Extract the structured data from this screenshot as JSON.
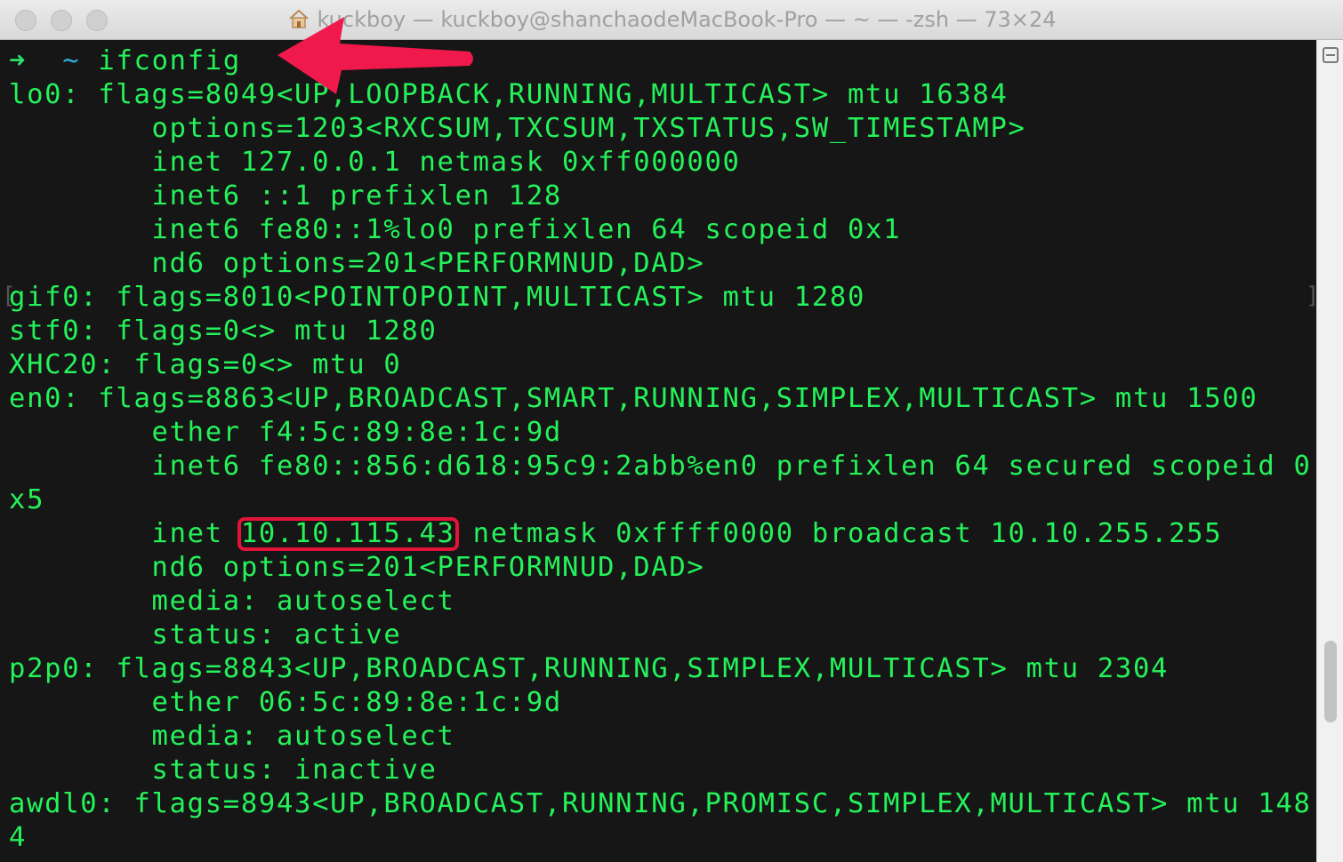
{
  "window": {
    "title": "kuckboy — kuckboy@shanchaodeMacBook-Pro — ~ — -zsh — 73×24"
  },
  "prompt": {
    "arrow": "➜",
    "dir": "~",
    "command": "ifconfig"
  },
  "terminal_lines": [
    "lo0: flags=8049<UP,LOOPBACK,RUNNING,MULTICAST> mtu 16384",
    "        options=1203<RXCSUM,TXCSUM,TXSTATUS,SW_TIMESTAMP>",
    "        inet 127.0.0.1 netmask 0xff000000",
    "        inet6 ::1 prefixlen 128",
    "        inet6 fe80::1%lo0 prefixlen 64 scopeid 0x1",
    "        nd6 options=201<PERFORMNUD,DAD>",
    "gif0: flags=8010<POINTOPOINT,MULTICAST> mtu 1280",
    "stf0: flags=0<> mtu 1280",
    "XHC20: flags=0<> mtu 0",
    "en0: flags=8863<UP,BROADCAST,SMART,RUNNING,SIMPLEX,MULTICAST> mtu 1500",
    "        ether f4:5c:89:8e:1c:9d",
    "        inet6 fe80::856:d618:95c9:2abb%en0 prefixlen 64 secured scopeid 0",
    "x5"
  ],
  "inet_line": {
    "prefix": "        inet ",
    "highlighted_ip": "10.10.115.43",
    "suffix": " netmask 0xffff0000 broadcast 10.10.255.255"
  },
  "terminal_lines_after": [
    "        nd6 options=201<PERFORMNUD,DAD>",
    "        media: autoselect",
    "        status: active",
    "p2p0: flags=8843<UP,BROADCAST,RUNNING,SIMPLEX,MULTICAST> mtu 2304",
    "        ether 06:5c:89:8e:1c:9d",
    "        media: autoselect",
    "        status: inactive",
    "awdl0: flags=8943<UP,BROADCAST,RUNNING,PROMISC,SIMPLEX,MULTICAST> mtu 148",
    "4"
  ],
  "colors": {
    "terminal_text": "#25f25a",
    "terminal_bg": "#161616",
    "highlight_box": "#e3143a",
    "annotation_arrow": "#f0194c",
    "tilde": "#2aaed8"
  },
  "icons": {
    "home": "home-icon",
    "annotation": "red-arrow-icon"
  }
}
